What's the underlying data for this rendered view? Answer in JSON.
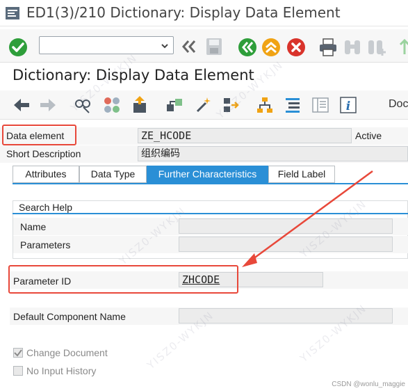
{
  "window": {
    "title": "ED1(3)/210 Dictionary: Display Data Element"
  },
  "toolbar": {
    "command_field_value": "",
    "icons": [
      "enter-icon",
      "collapse-icon",
      "save-icon",
      "back-icon",
      "exit-icon",
      "cancel-icon",
      "print-icon",
      "find-icon",
      "find-next-icon",
      "page-up-icon"
    ]
  },
  "screen": {
    "title": "Dictionary: Display Data Element",
    "app_toolbar_icons": [
      "back-arrow-icon",
      "forward-arrow-icon",
      "other-object-icon",
      "display-change-icon",
      "activate-icon",
      "check-icon",
      "where-used-icon",
      "magic-wand-icon",
      "navigate-icon",
      "hierarchy-icon",
      "outline-icon",
      "documentation-icon",
      "info-icon"
    ],
    "doc_button_label": "Doc"
  },
  "header_fields": {
    "data_element_label": "Data element",
    "data_element_value": "ZE_HCODE",
    "status": "Active",
    "short_description_label": "Short Description",
    "short_description_value": "组织编码"
  },
  "tabs": [
    {
      "label": "Attributes",
      "active": false
    },
    {
      "label": "Data Type",
      "active": false
    },
    {
      "label": "Further Characteristics",
      "active": true
    },
    {
      "label": "Field Label",
      "active": false
    }
  ],
  "search_help": {
    "title": "Search Help",
    "name_label": "Name",
    "name_value": "",
    "parameters_label": "Parameters",
    "parameters_value": ""
  },
  "parameter": {
    "label": "Parameter ID",
    "value": "ZHCODE"
  },
  "default_component": {
    "label": "Default Component Name",
    "value": ""
  },
  "checkboxes": {
    "change_document_label": "Change Document",
    "change_document_checked": true,
    "no_input_history_label": "No Input History",
    "no_input_history_checked": false
  },
  "watermark_text": "YISZ0-WYKJN",
  "credit": "CSDN @wonlu_maggie",
  "colors": {
    "accent_blue": "#2a8fd6",
    "annotation_red": "#e8483a",
    "enter_green": "#2e9e3a",
    "cancel_red": "#d9332b",
    "exit_orange": "#f0a314"
  }
}
